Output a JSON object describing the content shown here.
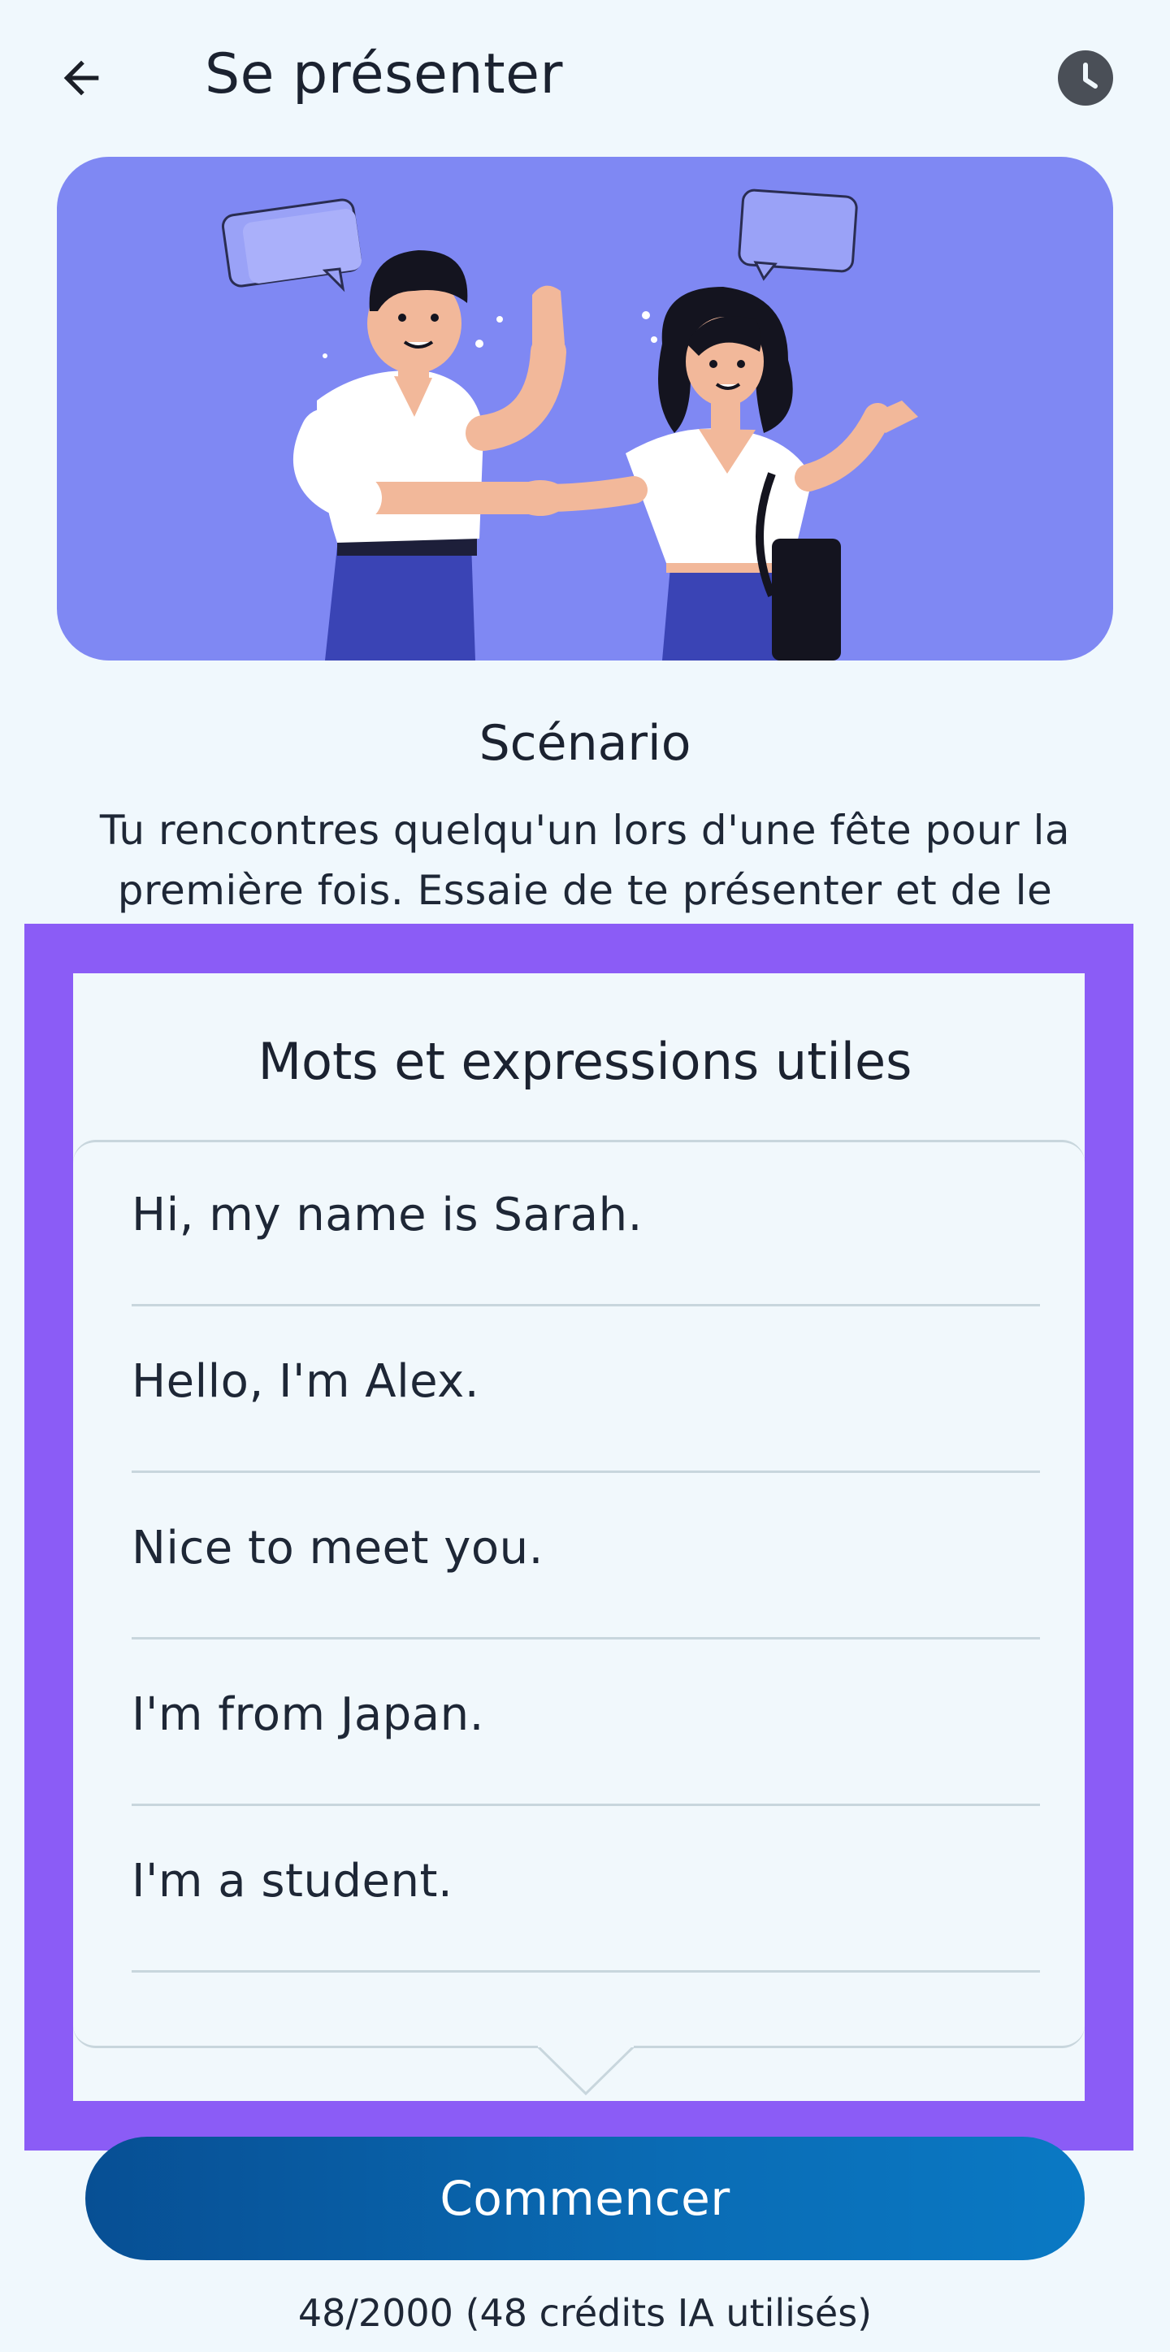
{
  "header": {
    "title": "Se présenter",
    "back_icon": "arrow-left-icon",
    "history_icon": "clock-icon"
  },
  "hero": {
    "illustration": "two-people-handshake-illustration",
    "background_color": "#7f88f3"
  },
  "scenario": {
    "title": "Scénario",
    "text": "Tu rencontres quelqu'un lors d'une fête pour la première fois. Essaie de te présenter et de le"
  },
  "phrases_card": {
    "title": "Mots et expressions utiles",
    "items": [
      "Hi, my name is Sarah.",
      "Hello, I'm Alex.",
      "Nice to meet you.",
      "I'm from Japan.",
      "I'm a student."
    ],
    "highlight_color": "#8b5cf6"
  },
  "footer": {
    "start_label": "Commencer",
    "credits_text": "48/2000 (48 crédits IA utilisés)"
  }
}
